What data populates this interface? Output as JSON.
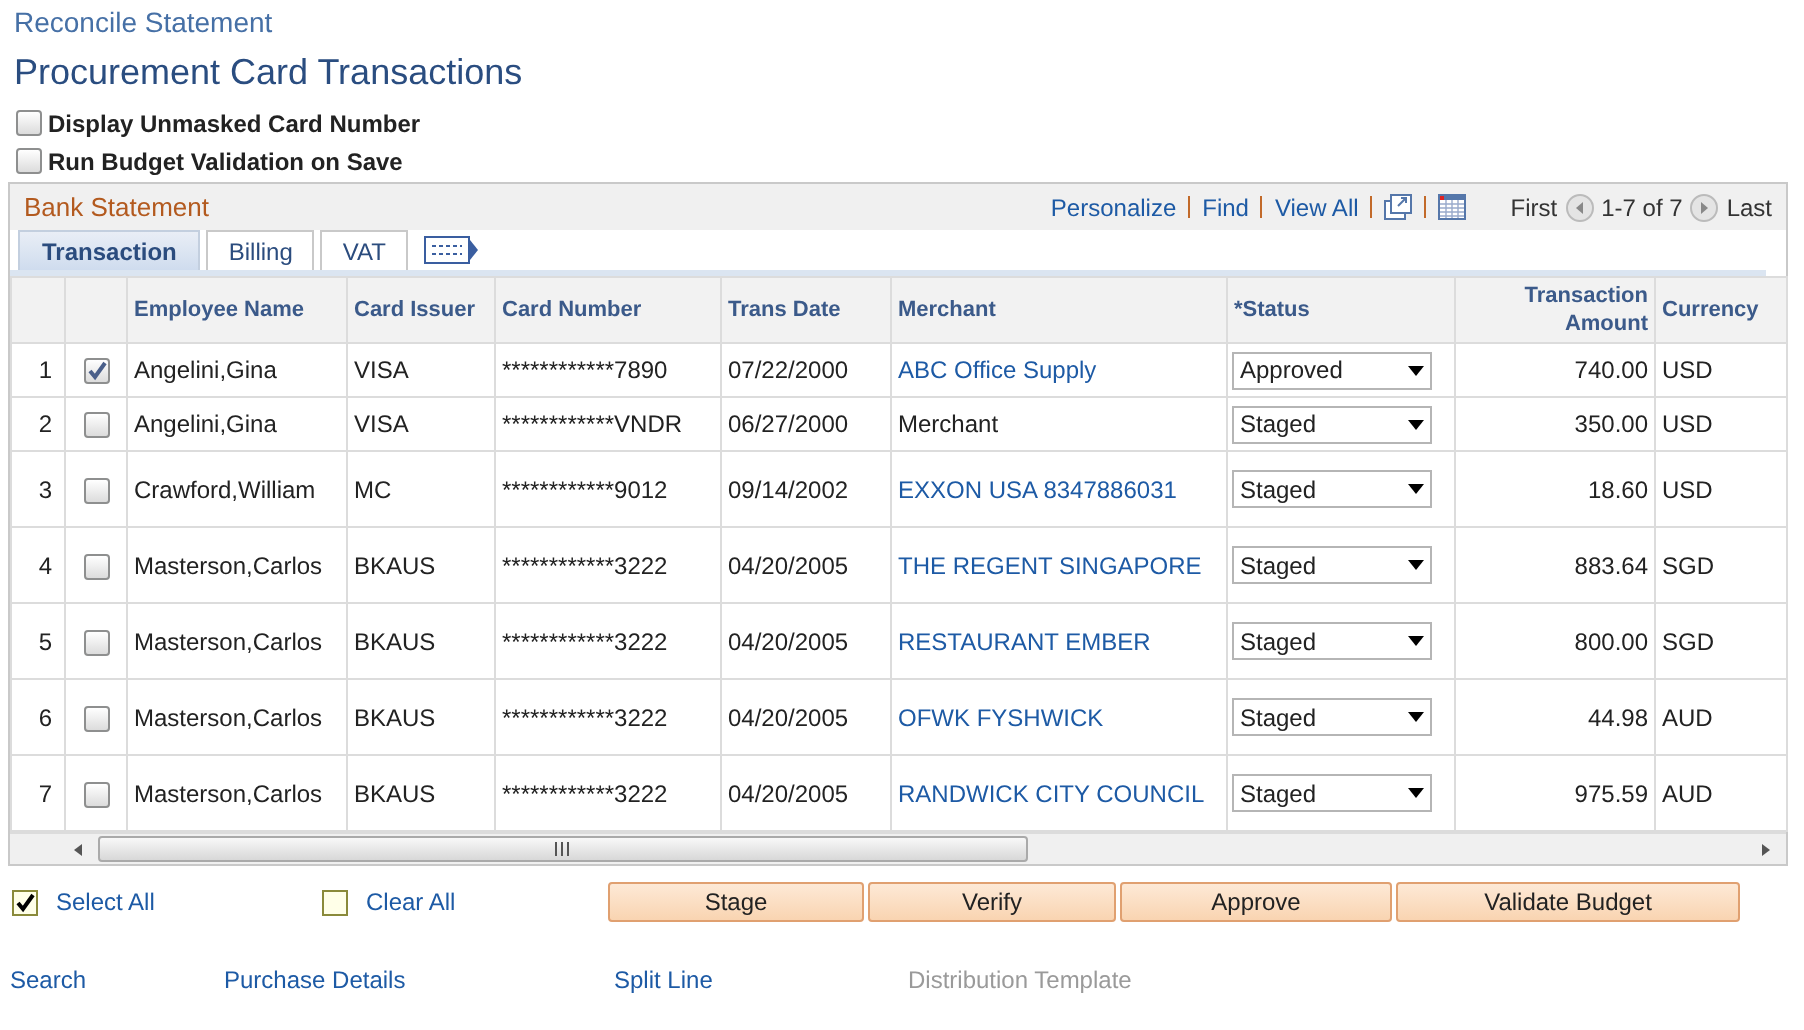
{
  "breadcrumb": "Reconcile Statement",
  "title": "Procurement Card Transactions",
  "options": [
    {
      "label": "Display Unmasked Card Number",
      "checked": false
    },
    {
      "label": "Run Budget Validation on Save",
      "checked": false
    }
  ],
  "grid": {
    "title": "Bank Statement",
    "tools": [
      "Personalize",
      "Find",
      "View All"
    ],
    "nav": {
      "first": "First",
      "range": "1-7 of 7",
      "last": "Last"
    },
    "tabs": [
      {
        "label": "Transaction",
        "selected": true
      },
      {
        "label": "Billing",
        "selected": false
      },
      {
        "label": "VAT",
        "selected": false
      }
    ],
    "columns": [
      "Employee Name",
      "Card Issuer",
      "Card Number",
      "Trans Date",
      "Merchant",
      "*Status",
      "Transaction Amount",
      "Currency"
    ],
    "rows": [
      {
        "num": "1",
        "checked": true,
        "employee": "Angelini,Gina",
        "issuer": "VISA",
        "card": "************7890",
        "date": "07/22/2000",
        "merchant": {
          "text": "ABC Office Supply",
          "kind": "link"
        },
        "status": "Approved",
        "amount": "740.00",
        "currency": "USD"
      },
      {
        "num": "2",
        "checked": false,
        "employee": "Angelini,Gina",
        "issuer": "VISA",
        "card": "************VNDR",
        "date": "06/27/2000",
        "merchant": {
          "text": "Merchant",
          "kind": "text"
        },
        "status": "Staged",
        "amount": "350.00",
        "currency": "USD"
      },
      {
        "num": "3",
        "checked": false,
        "employee": "Crawford,William",
        "issuer": "MC",
        "card": "************9012",
        "date": "09/14/2002",
        "merchant": {
          "text": "EXXON USA 8347886031",
          "kind": "link"
        },
        "status": "Staged",
        "amount": "18.60",
        "currency": "USD"
      },
      {
        "num": "4",
        "checked": false,
        "employee": "Masterson,Carlos",
        "issuer": "BKAUS",
        "card": "************3222",
        "date": "04/20/2005",
        "merchant": {
          "text": "THE REGENT SINGAPORE",
          "kind": "link"
        },
        "status": "Staged",
        "amount": "883.64",
        "currency": "SGD"
      },
      {
        "num": "5",
        "checked": false,
        "employee": "Masterson,Carlos",
        "issuer": "BKAUS",
        "card": "************3222",
        "date": "04/20/2005",
        "merchant": {
          "text": "RESTAURANT EMBER",
          "kind": "link"
        },
        "status": "Staged",
        "amount": "800.00",
        "currency": "SGD"
      },
      {
        "num": "6",
        "checked": false,
        "employee": "Masterson,Carlos",
        "issuer": "BKAUS",
        "card": "************3222",
        "date": "04/20/2005",
        "merchant": {
          "text": "OFWK FYSHWICK",
          "kind": "link"
        },
        "status": "Staged",
        "amount": "44.98",
        "currency": "AUD"
      },
      {
        "num": "7",
        "checked": false,
        "employee": "Masterson,Carlos",
        "issuer": "BKAUS",
        "card": "************3222",
        "date": "04/20/2005",
        "merchant": {
          "text": "RANDWICK CITY COUNCIL",
          "kind": "link"
        },
        "status": "Staged",
        "amount": "975.59",
        "currency": "AUD"
      }
    ]
  },
  "select_all": {
    "label": "Select All",
    "checked": true
  },
  "clear_all": {
    "label": "Clear All",
    "checked": false
  },
  "buttons": [
    "Stage",
    "Verify",
    "Approve",
    "Validate Budget"
  ],
  "links": [
    {
      "label": "Search",
      "disabled": false
    },
    {
      "label": "Purchase Details",
      "disabled": false
    },
    {
      "label": "Split Line",
      "disabled": false
    },
    {
      "label": "Distribution Template",
      "disabled": true
    }
  ]
}
